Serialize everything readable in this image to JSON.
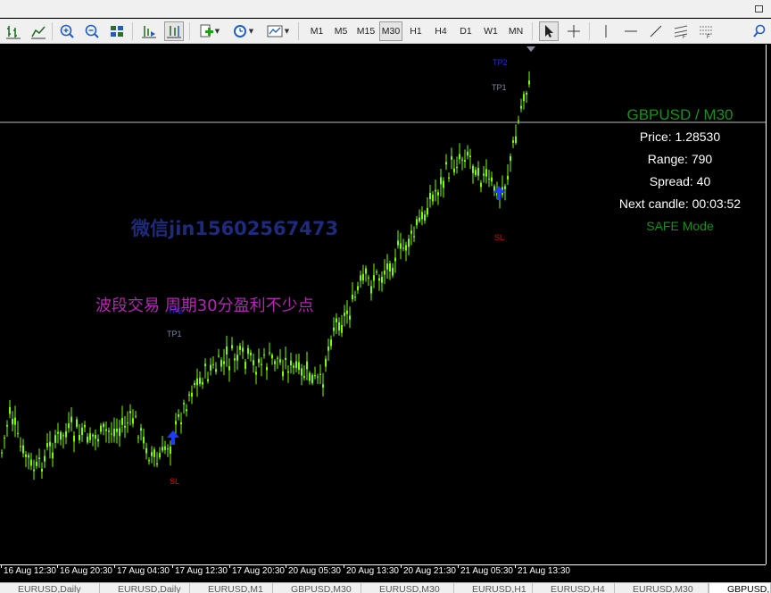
{
  "toolbar": {
    "timeframes": [
      "M1",
      "M5",
      "M15",
      "M30",
      "H1",
      "H4",
      "D1",
      "W1",
      "MN"
    ],
    "selected_timeframe": "M30"
  },
  "info_panel": {
    "symbol_line": "GBPUSD  /  M30",
    "price": "Price: 1.28530",
    "range": "Range: 790",
    "spread": "Spread: 40",
    "next_candle": "Next candle: 00:03:52",
    "mode": "SAFE Mode"
  },
  "overlay": {
    "wechat": "微信jin15602567473",
    "promo": "波段交易 周期30分盈利不少点"
  },
  "markers": {
    "tp2": "TP2",
    "tp1": "TP1",
    "sl": "SL"
  },
  "time_axis": {
    "labels": [
      "16 Aug 12:30",
      "16 Aug 20:30",
      "17 Aug 04:30",
      "17 Aug 12:30",
      "17 Aug 20:30",
      "20 Aug 05:30",
      "20 Aug 13:30",
      "20 Aug 21:30",
      "21 Aug 05:30",
      "21 Aug 13:30"
    ]
  },
  "tabs": [
    {
      "label": "EURUSD,Daily",
      "active": false
    },
    {
      "label": "EURUSD,Daily",
      "active": false
    },
    {
      "label": "EURUSD,M1",
      "active": false
    },
    {
      "label": "GBPUSD,M30",
      "active": false
    },
    {
      "label": "EURUSD,M30",
      "active": false
    },
    {
      "label": "EURUSD,H1",
      "active": false
    },
    {
      "label": "EURUSD,H4",
      "active": false
    },
    {
      "label": "EURUSD,M30",
      "active": false
    },
    {
      "label": "GBPUSD,M30",
      "active": true
    }
  ],
  "colors": {
    "background": "#000000",
    "candles": "#7cfc00",
    "symbol_text": "#1a8f1a",
    "wechat_text": "#1f2a7a",
    "promo_text": "#b02ab0",
    "sl_marker": "#dd1111",
    "entry_arrow": "#1e3cff"
  },
  "icons": [
    "bar-chart-icon",
    "line-chart-icon",
    "zoom-in-icon",
    "zoom-out-icon",
    "tile-windows-icon",
    "chart-shift-icon",
    "autoscroll-icon",
    "new-order-icon",
    "clock-icon",
    "templates-icon",
    "cursor-icon",
    "crosshair-icon",
    "vertical-line-icon",
    "horizontal-line-icon",
    "trendline-icon",
    "channel-icon",
    "fibonacci-icon",
    "search-icon"
  ]
}
